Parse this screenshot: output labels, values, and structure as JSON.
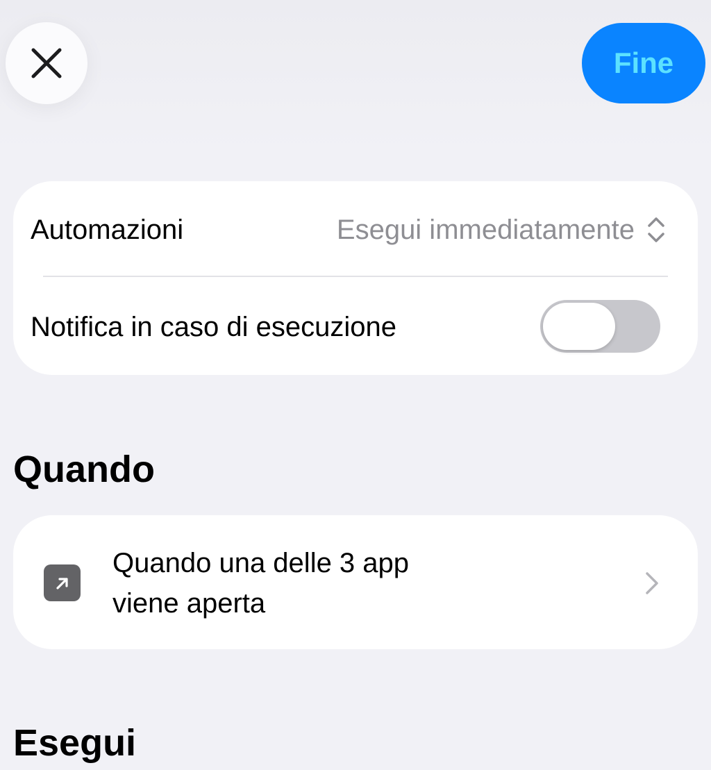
{
  "header": {
    "close_icon": "xmark-icon",
    "done_label": "Fine",
    "done_color": "#0a84ff"
  },
  "settings": {
    "automations_label": "Automazioni",
    "automations_value": "Esegui immediatamente",
    "automations_value_icon": "chevron-up-down-icon",
    "notify_label": "Notifica in caso di esecuzione",
    "notify_enabled": false
  },
  "when_section": {
    "title": "Quando",
    "trigger": {
      "icon": "arrow-up-right-square-icon",
      "line1": "Quando una delle 3 app",
      "line2": "viene aperta",
      "chevron_icon": "chevron-right-icon"
    }
  },
  "run_section": {
    "title": "Esegui"
  },
  "colors": {
    "background": "#f1f1f6",
    "card": "#ffffff",
    "secondary_text": "#8e8e93",
    "toggle_off": "#c7c7cc"
  }
}
